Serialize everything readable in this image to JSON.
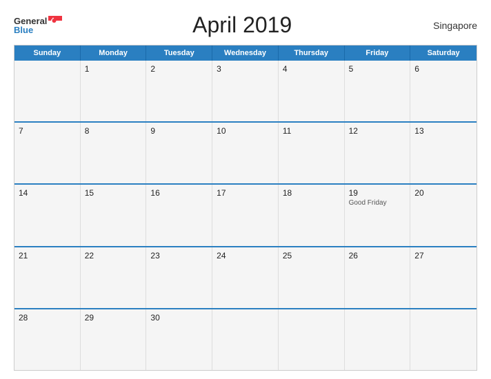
{
  "header": {
    "logo_general": "General",
    "logo_blue": "Blue",
    "logo_flag_unicode": "🔵",
    "title": "April 2019",
    "country": "Singapore"
  },
  "calendar": {
    "weekdays": [
      "Sunday",
      "Monday",
      "Tuesday",
      "Wednesday",
      "Thursday",
      "Friday",
      "Saturday"
    ],
    "weeks": [
      [
        {
          "day": "",
          "empty": true
        },
        {
          "day": "1"
        },
        {
          "day": "2"
        },
        {
          "day": "3"
        },
        {
          "day": "4"
        },
        {
          "day": "5"
        },
        {
          "day": "6"
        }
      ],
      [
        {
          "day": "7"
        },
        {
          "day": "8"
        },
        {
          "day": "9"
        },
        {
          "day": "10"
        },
        {
          "day": "11"
        },
        {
          "day": "12"
        },
        {
          "day": "13"
        }
      ],
      [
        {
          "day": "14"
        },
        {
          "day": "15"
        },
        {
          "day": "16"
        },
        {
          "day": "17"
        },
        {
          "day": "18"
        },
        {
          "day": "19",
          "holiday": "Good Friday"
        },
        {
          "day": "20"
        }
      ],
      [
        {
          "day": "21"
        },
        {
          "day": "22"
        },
        {
          "day": "23"
        },
        {
          "day": "24"
        },
        {
          "day": "25"
        },
        {
          "day": "26"
        },
        {
          "day": "27"
        }
      ],
      [
        {
          "day": "28"
        },
        {
          "day": "29"
        },
        {
          "day": "30"
        },
        {
          "day": "",
          "empty": true
        },
        {
          "day": "",
          "empty": true
        },
        {
          "day": "",
          "empty": true
        },
        {
          "day": "",
          "empty": true
        }
      ]
    ],
    "accent_color": "#2a7fc1"
  }
}
